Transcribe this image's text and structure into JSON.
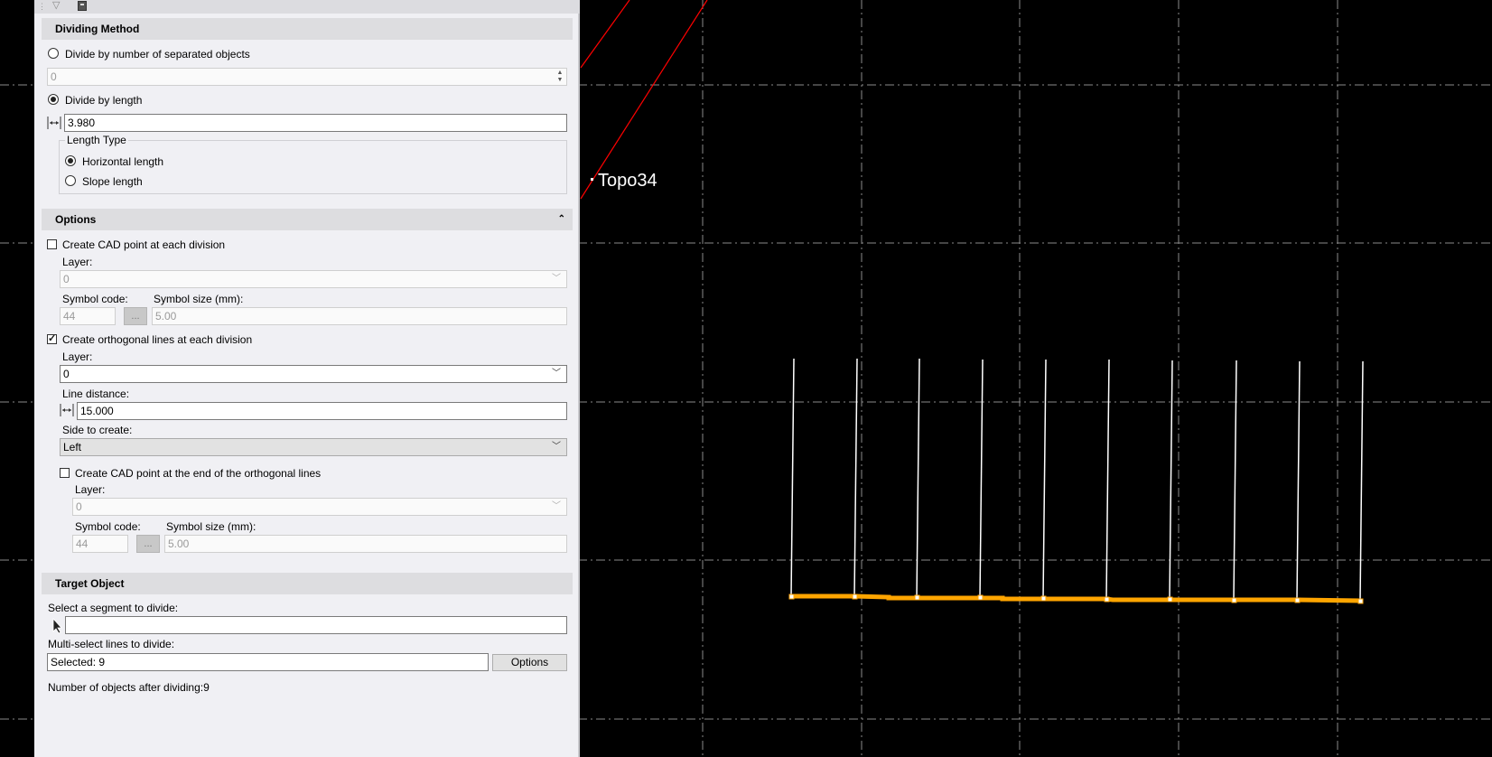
{
  "dividing_method": {
    "header": "Dividing Method",
    "by_count_label": "Divide by number of separated objects",
    "count_value": "0",
    "by_length_label": "Divide by length",
    "length_value": "3.980",
    "length_type": {
      "title": "Length Type",
      "horizontal_label": "Horizontal length",
      "slope_label": "Slope length"
    }
  },
  "options": {
    "header": "Options",
    "cad_point_label": "Create CAD point at each division",
    "layer_label": "Layer:",
    "cad_point_layer": "0",
    "symbol_code_label": "Symbol code:",
    "symbol_code": "44",
    "browse_label": "...",
    "symbol_size_label": "Symbol size (mm):",
    "symbol_size": "5.00",
    "orth_lines_label": "Create orthogonal lines at each division",
    "orth_layer_label": "Layer:",
    "orth_layer": "0",
    "line_distance_label": "Line distance:",
    "line_distance": "15.000",
    "side_label": "Side to create:",
    "side_value": "Left",
    "end_point_label": "Create CAD point at the end of the orthogonal lines",
    "end_layer_label": "Layer:",
    "end_layer": "0",
    "end_symbol_code_label": "Symbol code:",
    "end_symbol_code": "44",
    "end_browse_label": "...",
    "end_symbol_size_label": "Symbol size (mm):",
    "end_symbol_size": "5.00"
  },
  "target": {
    "header": "Target Object",
    "select_segment_label": "Select a segment to divide:",
    "segment_value": "",
    "multi_select_label": "Multi-select lines to divide:",
    "selected_value": "Selected: 9",
    "options_button": "Options",
    "result_text": "Number of objects after dividing:9"
  },
  "cad_view": {
    "point_label": "Topo34",
    "colors": {
      "background": "#000000",
      "grid": "#8a8a8a",
      "segment": "#ffa500",
      "ortho_lines": "#ffffff",
      "red_line": "#ff0000"
    }
  }
}
